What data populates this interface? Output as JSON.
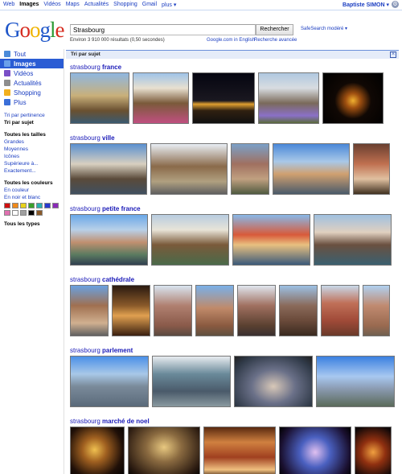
{
  "nav": {
    "items": [
      "Web",
      "Images",
      "Vidéos",
      "Maps",
      "Actualités",
      "Shopping",
      "Gmail",
      "plus ▾"
    ],
    "user": "Baptiste SIMON ▾"
  },
  "logo": [
    "G",
    "o",
    "o",
    "g",
    "l",
    "e"
  ],
  "search": {
    "value": "Strasbourg",
    "button": "Rechercher",
    "safesearch": "SafeSearch modéré ▾",
    "results": "Environ 3 910 000 résultats (0,50 secondes)",
    "english": "Google.com in English",
    "advanced": "Recherche avancée"
  },
  "sidebar": {
    "types": [
      {
        "label": "Tout",
        "icon": "web-icon",
        "color": "#4b8bd9"
      },
      {
        "label": "Images",
        "icon": "images-icon",
        "color": "#6aa0ea"
      },
      {
        "label": "Vidéos",
        "icon": "videos-icon",
        "color": "#7a4fc7"
      },
      {
        "label": "Actualités",
        "icon": "news-icon",
        "color": "#8e8e8e"
      },
      {
        "label": "Shopping",
        "icon": "shopping-icon",
        "color": "#f2b01e"
      },
      {
        "label": "Plus",
        "icon": "more-icon",
        "color": "#3a6fd8"
      }
    ],
    "sort": [
      "Tri par pertinence",
      "Tri par sujet"
    ],
    "sizes": [
      "Toutes les tailles",
      "Grandes",
      "Moyennes",
      "Icônes",
      "Supérieure à...",
      "Exactement..."
    ],
    "colors_title": "Toutes les couleurs",
    "color_options": [
      "En couleur",
      "En noir et blanc"
    ],
    "swatches": [
      "#d01010",
      "#f08a1a",
      "#e8d21a",
      "#3aa02a",
      "#2ab0b0",
      "#2a3ad0",
      "#8a2ab8",
      "#e070b0",
      "#ffffff",
      "#a0a0a0",
      "#000000",
      "#8a5a2a"
    ],
    "types_all": "Tous les types"
  },
  "sortbar": {
    "label": "Tri par sujet",
    "close": "×"
  },
  "groups": [
    {
      "prefix": "strasbourg",
      "suffix": "france",
      "thumbs": [
        {
          "w": 74,
          "bg": "linear-gradient(#8fb7e0 0%,#c9b07a 45%,#6a5030 75%,#3a5a70 100%)"
        },
        {
          "w": 70,
          "bg": "linear-gradient(#9fc3e8 0%,#e8e0d0 30%,#7a5a3a 60%,#c05080 100%)"
        },
        {
          "w": 78,
          "bg": "linear-gradient(#050510 0%,#1a1820 55%,#e0a030 62%,#302010 75%,#101010 100%)"
        },
        {
          "w": 76,
          "bg": "linear-gradient(#b0c8e0 0%,#d8dce0 30%,#7a6a5a 60%,#8a70c8 85%,#5a6a3a 100%)"
        },
        {
          "w": 76,
          "bg": "radial-gradient(circle at 50% 55%,#f0b030 0%,#a05010 18%,#100804 45%,#000 100%)"
        }
      ]
    },
    {
      "prefix": "strasbourg",
      "suffix": "ville",
      "thumbs": [
        {
          "w": 96,
          "bg": "linear-gradient(#5a90d0 0%,#d8d0c0 40%,#5a4a3a 70%,#405060 100%)"
        },
        {
          "w": 96,
          "bg": "linear-gradient(#e8eef4 0%,#8a6a4a 45%,#b0a080 75%,#606060 100%)"
        },
        {
          "w": 48,
          "bg": "linear-gradient(#7aa0c8 0%,#a07060 40%,#c0a080 70%,#505a40 100%)"
        },
        {
          "w": 96,
          "bg": "linear-gradient(#4a88d8 0%,#a8c8e8 35%,#d0a070 60%,#4a5a6a 100%)"
        },
        {
          "w": 46,
          "bg": "linear-gradient(#6a4030 0%,#c07050 40%,#e0c0a0 70%,#403020 100%)"
        }
      ]
    },
    {
      "prefix": "strasbourg",
      "suffix": "petite france",
      "thumbs": [
        {
          "w": 97,
          "bg": "linear-gradient(#6aa8e8 0%,#b8d0e8 30%,#c09070 55%,#5a7a60 80%,#304050 100%)"
        },
        {
          "w": 97,
          "bg": "linear-gradient(#b8cce0 0%,#e8e4d8 30%,#7a5a3a 60%,#4a6a4a 100%)"
        },
        {
          "w": 97,
          "bg": "linear-gradient(#88b8e8 0%,#d85a3a 40%,#e8c080 60%,#3a5a7a 100%)"
        },
        {
          "w": 97,
          "bg": "linear-gradient(#a0c0e0 0%,#e0d0c0 35%,#6a5040 60%,#3a6070 100%)"
        }
      ]
    },
    {
      "prefix": "strasbourg",
      "suffix": "cathédrale",
      "thumbs": [
        {
          "w": 48,
          "bg": "linear-gradient(#6aa0e0 0%,#a07050 40%,#d0b090 75%,#606060 100%)"
        },
        {
          "w": 48,
          "bg": "linear-gradient(#2a1a10 0%,#8a5a2a 40%,#e0a050 60%,#3a2010 100%)"
        },
        {
          "w": 48,
          "bg": "linear-gradient(#d8e4f0 0%,#b08070 40%,#8a5a4a 80%,#5a4a40 100%)"
        },
        {
          "w": 48,
          "bg": "linear-gradient(#7ab0e8 0%,#c08a6a 45%,#8a5a40 80%,#605040 100%)"
        },
        {
          "w": 48,
          "bg": "linear-gradient(#e0e6ee 0%,#a07060 40%,#5a4030 80%,#3a3030 100%)"
        },
        {
          "w": 48,
          "bg": "linear-gradient(#9cc0e4 0%,#8a6a5a 40%,#6a4a3a 70%,#3a2a20 100%)"
        },
        {
          "w": 48,
          "bg": "linear-gradient(#c8d8e8 0%,#c07058 35%,#a04a38 70%,#6a3a2a 100%)"
        },
        {
          "w": 34,
          "bg": "linear-gradient(#b0d0f0 0%,#c08a70 40%,#9a6a50 80%,#706050 100%)"
        }
      ]
    },
    {
      "prefix": "strasbourg",
      "suffix": "parlement",
      "thumbs": [
        {
          "w": 98,
          "bg": "linear-gradient(#4a90e8 0%,#a8c8e8 35%,#7a8a9a 60%,#5a6a7a 100%)"
        },
        {
          "w": 98,
          "bg": "linear-gradient(#e8ecf0 0%,#6a8a9a 35%,#4a5a6a 70%,#8a9aa0 100%)"
        },
        {
          "w": 98,
          "bg": "radial-gradient(ellipse at 50% 60%,#d8c8b8 0%,#6a7088 40%,#303a48 80%,#202020 100%)"
        },
        {
          "w": 98,
          "bg": "linear-gradient(#3a80e0 0%,#a8c8f0 40%,#8a9ab0 65%,#5a6a5a 100%)"
        }
      ]
    },
    {
      "prefix": "strasbourg",
      "suffix": "marché de noel",
      "thumbs": [
        {
          "w": 68,
          "bg": "radial-gradient(circle at 45% 45%,#f0c050 0%,#a06020 30%,#201008 70%,#000 100%)"
        },
        {
          "w": 90,
          "bg": "radial-gradient(ellipse at 50% 40%,#e8c880 0%,#8a6a40 35%,#2a1a10 80%,#000 100%)"
        },
        {
          "w": 90,
          "bg": "linear-gradient(#5a2a10 0%,#d08040 30%,#a04020 60%,#f0c080 85%,#3a2010 100%)"
        },
        {
          "w": 90,
          "bg": "radial-gradient(circle at 50% 50%,#e0c0f0 0%,#4a60c0 35%,#1a1030 80%,#000 100%)"
        },
        {
          "w": 46,
          "bg": "radial-gradient(circle at 50% 50%,#f0a040 0%,#903010 40%,#100808 90%)"
        }
      ]
    }
  ]
}
